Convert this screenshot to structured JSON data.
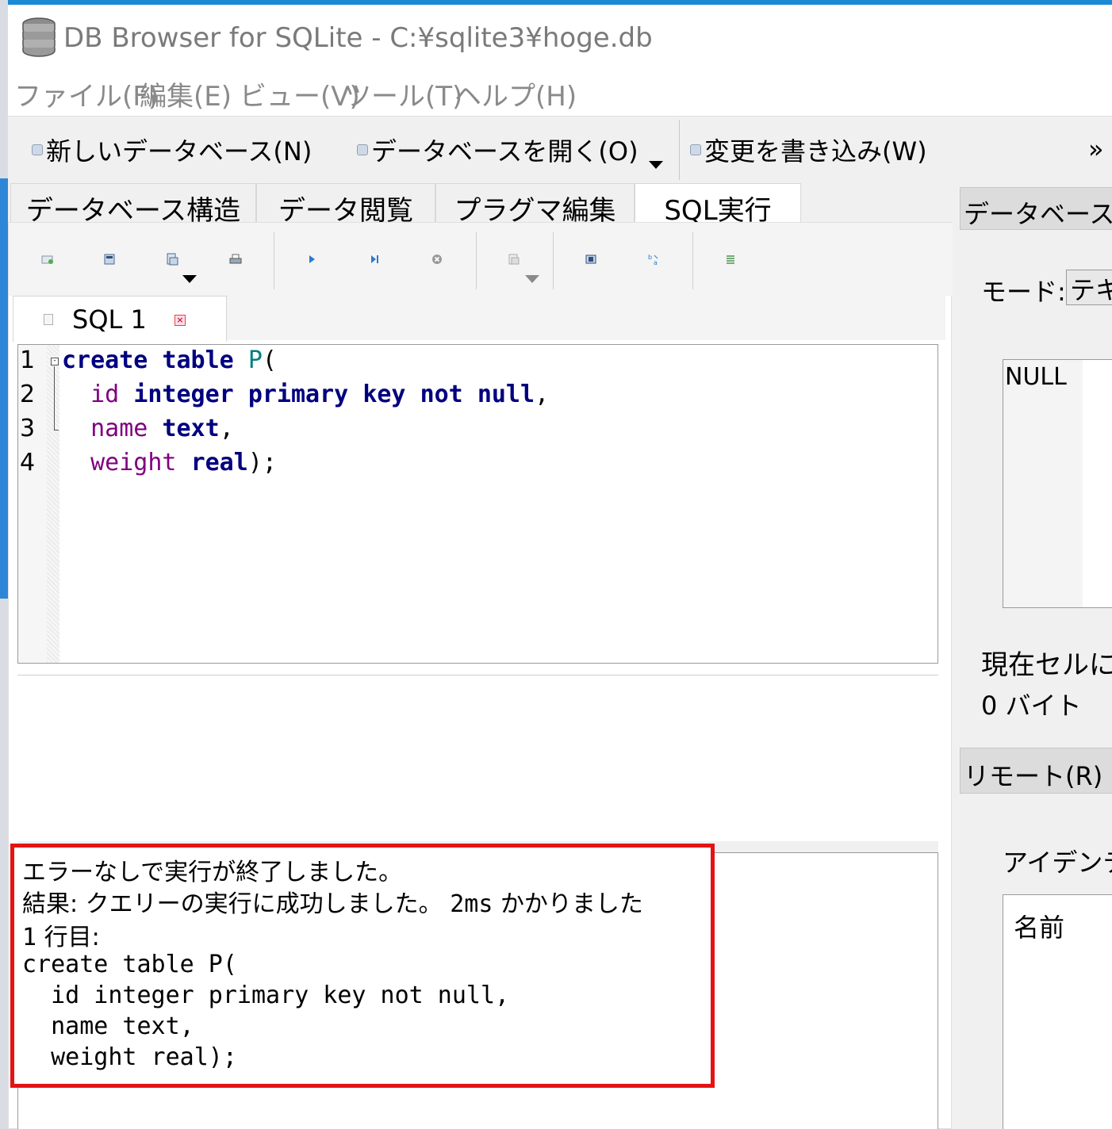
{
  "window": {
    "title": "DB Browser for SQLite - C:¥sqlite3¥hoge.db"
  },
  "menubar": {
    "items": [
      "ファイル(F)",
      "編集(E)",
      "ビュー(V)",
      "ツール(T)",
      "ヘルプ(H)"
    ]
  },
  "toolbar": {
    "new_database": "新しいデータベース(N)",
    "open_database": "データベースを開く(O)",
    "write_changes": "変更を書き込み(W)",
    "more": "»"
  },
  "main_tabs": [
    {
      "label": "データベース構造",
      "active": false
    },
    {
      "label": "データ閲覧",
      "active": false
    },
    {
      "label": "プラグマ編集",
      "active": false
    },
    {
      "label": "SQL実行",
      "active": true
    }
  ],
  "sql_tab": {
    "label": "SQL 1"
  },
  "editor": {
    "line_numbers": [
      "1",
      "2",
      "3",
      "4"
    ]
  },
  "messages": {
    "line1": "エラーなしで実行が終了しました。",
    "result_label": "結果: クエリーの実行に成功しました。",
    "duration": "2ms",
    "duration_suffix": "かかりました",
    "row_number": "1",
    "row_label": "行目:",
    "query_lines": [
      "create table P(",
      "  id integer primary key not null,",
      "  name text,",
      "  weight real);"
    ]
  },
  "right_dock": {
    "title": "データベースの",
    "mode_label": "モード:",
    "mode_value": "テキ",
    "cell_value": "NULL",
    "cell_size_label": "現在セルにあ",
    "cell_bytes": "0 バイト",
    "remote_title": "リモート(R)",
    "identity_label": "アイデンティ",
    "identity_name_header": "名前"
  },
  "colors": {
    "keyword": "#00007f",
    "table_name": "#007f7f",
    "identifier": "#7f007f",
    "highlight_border": "#e21414"
  },
  "icons": {
    "app": "database-icon",
    "sql_toolbar": [
      "open-tab-icon",
      "open-sql-file-icon",
      "save-sql-file-icon",
      "print-icon",
      "execute-all-icon",
      "execute-current-line-icon",
      "stop-execution-icon",
      "save-results-icon",
      "find-icon",
      "find-replace-icon",
      "comment-toggle-icon"
    ]
  }
}
